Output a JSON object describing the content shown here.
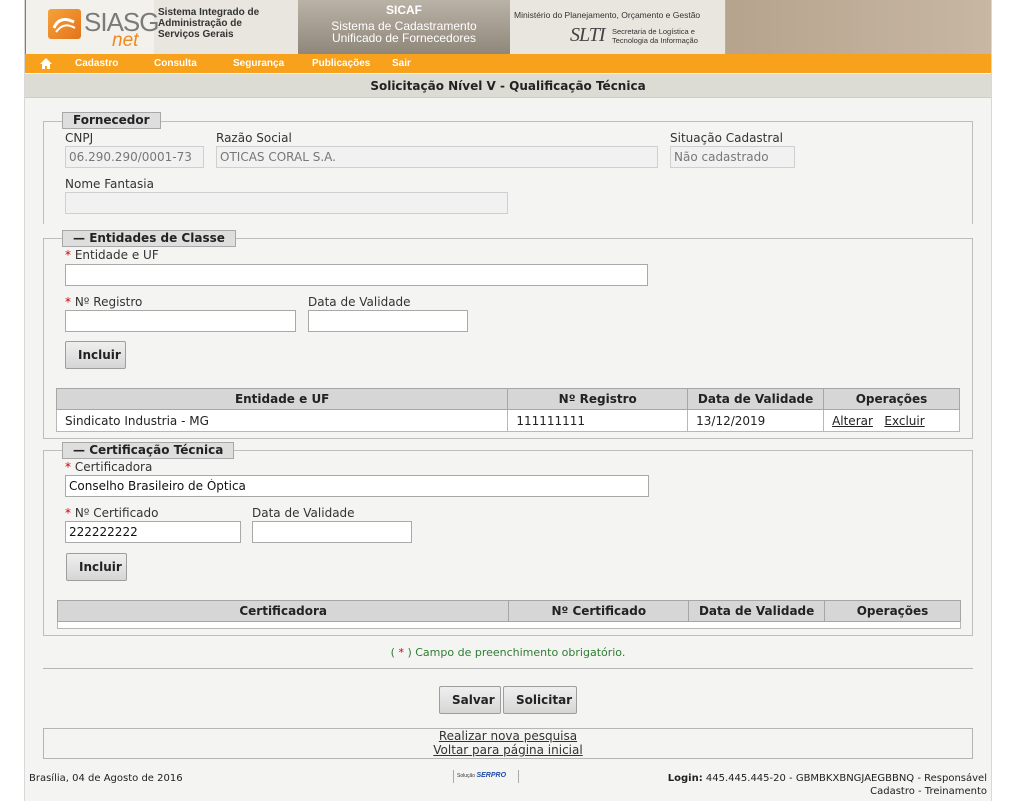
{
  "banner": {
    "logo_text": "SIASG",
    "logo_sub": "net",
    "system_lines": [
      "Sistema Integrado de",
      "Administração de",
      "Serviços Gerais"
    ],
    "sicaf_title": "SICAF",
    "sicaf_sub_lines": [
      "Sistema de Cadastramento",
      "Unificado de Fornecedores"
    ],
    "ministry": "Ministério do Planejamento, Orçamento e Gestão",
    "slti_logo": "SLTI",
    "slti_lines": [
      "Secretaria de Logística e",
      "Tecnologia da Informação"
    ]
  },
  "nav": {
    "home_icon": "home-icon",
    "items": [
      "Cadastro",
      "Consulta",
      "Segurança",
      "Publicações",
      "Sair"
    ]
  },
  "page_title": "Solicitação Nível V - Qualificação Técnica",
  "fornecedor": {
    "legend": "Fornecedor",
    "cnpj_label": "CNPJ",
    "cnpj_value": "06.290.290/0001-73",
    "razao_label": "Razão Social",
    "razao_value": "OTICAS CORAL S.A.",
    "situacao_label": "Situação Cadastral",
    "situacao_value": "Não cadastrado",
    "fantasia_label": "Nome Fantasia",
    "fantasia_value": ""
  },
  "entidades": {
    "legend": "Entidades de Classe",
    "entidade_label": "Entidade e UF",
    "entidade_value": "",
    "registro_label": "Nº Registro",
    "registro_value": "",
    "validade_label": "Data de Validade",
    "validade_value": "",
    "include_button": "Incluir",
    "columns": [
      "Entidade e UF",
      "Nº Registro",
      "Data de Validade",
      "Operações"
    ],
    "rows": [
      {
        "entidade": "Sindicato Industria - MG",
        "registro": "111111111",
        "validade": "13/12/2019",
        "alterar": "Alterar",
        "excluir": "Excluir"
      }
    ]
  },
  "certificacao": {
    "legend": "Certificação Técnica",
    "certificadora_label": "Certificadora",
    "certificadora_value": "Conselho Brasileiro de Óptica",
    "certificado_label": "Nº Certificado",
    "certificado_value": "222222222",
    "validade_label": "Data de Validade",
    "validade_value": "",
    "include_button": "Incluir",
    "columns": [
      "Certificadora",
      "Nº Certificado",
      "Data de Validade",
      "Operações"
    ]
  },
  "required_note": {
    "open": "(",
    "star": "*",
    "text": ") Campo de preenchimento obrigatório."
  },
  "actions": {
    "save": "Salvar",
    "request": "Solicitar"
  },
  "links": {
    "new_search": "Realizar nova pesquisa",
    "home": "Voltar para página inicial"
  },
  "footer": {
    "date": "Brasília, 04 de Agosto de 2016",
    "serpro_prefix": "Solução",
    "serpro_name": "SERPRO",
    "login_label": "Login:",
    "login_value": "445.445.445-20 - GBMBKXBNGJAEGBBNQ - Responsável",
    "login_role": "Cadastro - Treinamento"
  }
}
